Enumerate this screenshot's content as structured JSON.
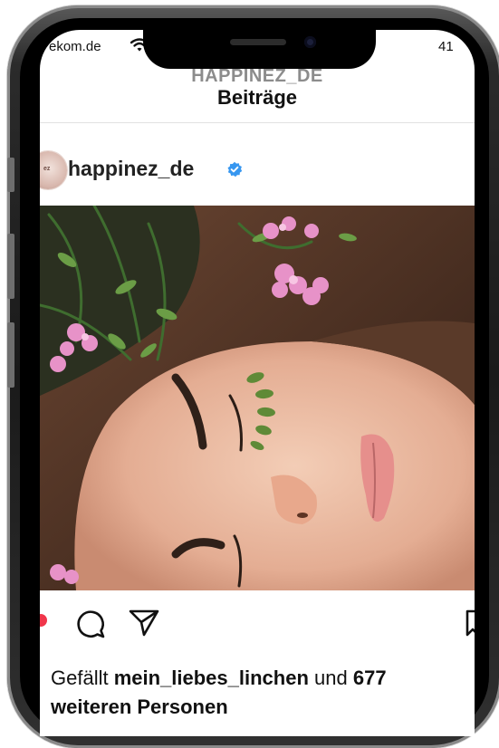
{
  "status_bar": {
    "carrier": "ekom.de",
    "battery": "41"
  },
  "header": {
    "subtitle": "HAPPINEZ_DE",
    "title": "Beiträge"
  },
  "post": {
    "username": "happinez_de",
    "verified": true,
    "avatar_text": "ez",
    "likes_prefix": "Gefällt ",
    "likes_user": "mein_liebes_linchen",
    "likes_middle": " und ",
    "likes_count": "677",
    "likes_suffix": "weiteren Personen"
  },
  "icons": [
    "wifi-icon",
    "verified-badge-icon",
    "like-heart-icon",
    "comment-icon",
    "share-icon",
    "bookmark-icon"
  ],
  "colors": {
    "verified": "#3797f0",
    "like": "#f0364b",
    "text": "#111111",
    "subtitle": "#8c8c8c"
  }
}
